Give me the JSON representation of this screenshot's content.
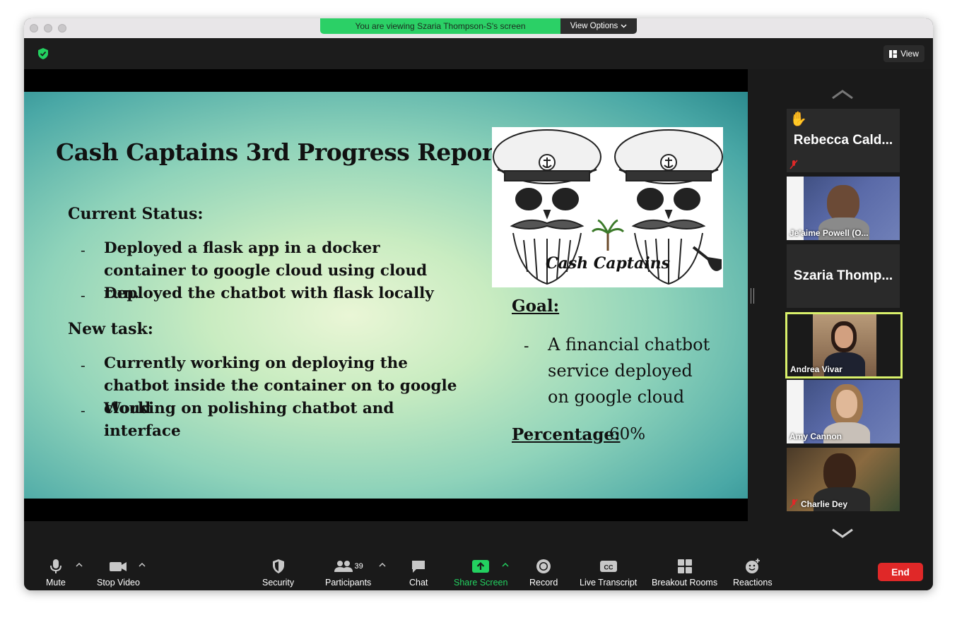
{
  "banner": {
    "viewing_text": "You are viewing Szaria Thompson-S's screen",
    "view_options_label": "View Options"
  },
  "topbar": {
    "view_label": "View"
  },
  "slide": {
    "title": "Cash Captains 3rd Progress Report",
    "current_status_heading": "Current Status:",
    "current_status_items": [
      "Deployed a flask app in a docker container to google cloud using cloud run.",
      "Deployed the chatbot with flask locally"
    ],
    "new_task_heading": "New task:",
    "new_task_items": [
      "Currently working on deploying the chatbot inside the container on to google cloud",
      "Working on polishing chatbot and interface"
    ],
    "logo_text": "Cash Captains",
    "goal_label": "Goal:",
    "goal_text": "A financial chatbot service deployed on google cloud",
    "percentage_label": "Percentage:",
    "percentage_value": "60%"
  },
  "participants": [
    {
      "name": "Rebecca Cald...",
      "video": false,
      "muted": true,
      "hand_raised": true
    },
    {
      "name": "Je'aime Powell (O...",
      "video": true,
      "muted": false
    },
    {
      "name": "Szaria Thomp...",
      "video": false,
      "muted": false
    },
    {
      "name": "Andrea Vivar",
      "video": true,
      "muted": false,
      "active_speaker": true
    },
    {
      "name": "Amy Cannon",
      "video": true,
      "muted": false
    },
    {
      "name": "Charlie Dey",
      "video": true,
      "muted": true
    }
  ],
  "toolbar": {
    "mute": "Mute",
    "stop_video": "Stop Video",
    "security": "Security",
    "participants": "Participants",
    "participant_count": "39",
    "chat": "Chat",
    "share_screen": "Share Screen",
    "record": "Record",
    "live_transcript": "Live Transcript",
    "breakout_rooms": "Breakout Rooms",
    "reactions": "Reactions",
    "end": "End"
  },
  "colors": {
    "share_green": "#23d160",
    "end_red": "#e02828",
    "active_speaker_border": "#d9f16b",
    "toolbar_bg": "#1a1a1a"
  },
  "icons": [
    "microphone-icon",
    "video-camera-icon",
    "shield-icon",
    "people-icon",
    "chat-bubble-icon",
    "share-arrow-icon",
    "record-icon",
    "cc-icon",
    "grid-icon",
    "emoji-icon",
    "chevron-up-icon",
    "chevron-down-icon",
    "raised-hand-icon",
    "muted-mic-icon"
  ]
}
